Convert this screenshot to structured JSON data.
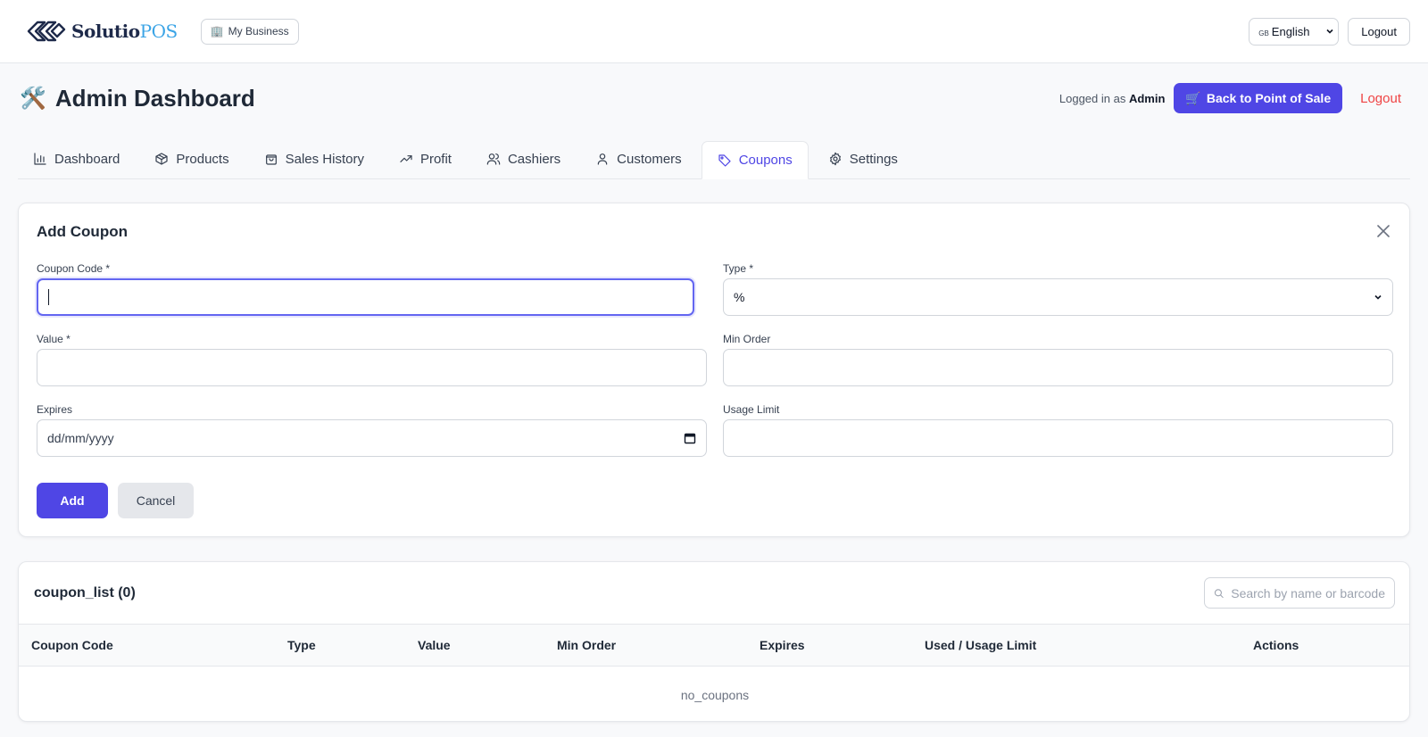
{
  "topbar": {
    "logo_text": "Solutio",
    "logo_text_accent": "POS",
    "business_label": "My Business",
    "language": "English",
    "language_flag": "GB",
    "logout_label": "Logout"
  },
  "header": {
    "title": "Admin Dashboard",
    "logged_in_prefix": "Logged in as",
    "logged_in_user": "Admin",
    "back_to_pos_label": "Back to Point of Sale",
    "logout_label": "Logout"
  },
  "tabs": [
    {
      "label": "Dashboard",
      "icon": "bar-chart-icon"
    },
    {
      "label": "Products",
      "icon": "box-icon"
    },
    {
      "label": "Sales History",
      "icon": "shopping-bag-icon"
    },
    {
      "label": "Profit",
      "icon": "trending-up-icon"
    },
    {
      "label": "Cashiers",
      "icon": "users-icon"
    },
    {
      "label": "Customers",
      "icon": "user-icon"
    },
    {
      "label": "Coupons",
      "icon": "tag-icon",
      "active": true
    },
    {
      "label": "Settings",
      "icon": "gear-icon"
    }
  ],
  "form": {
    "title": "Add Coupon",
    "coupon_code_label": "Coupon Code *",
    "coupon_code_value": "",
    "type_label": "Type *",
    "type_value": "%",
    "value_label": "Value *",
    "value_value": "",
    "min_order_label": "Min Order",
    "min_order_value": "",
    "expires_label": "Expires",
    "expires_placeholder": "dd/mm/yyyy",
    "usage_limit_label": "Usage Limit",
    "usage_limit_value": "",
    "add_label": "Add",
    "cancel_label": "Cancel"
  },
  "list": {
    "title": "coupon_list (0)",
    "search_placeholder": "Search by name or barcode",
    "columns": [
      "Coupon Code",
      "Type",
      "Value",
      "Min Order",
      "Expires",
      "Used / Usage Limit",
      "Actions"
    ],
    "empty_text": "no_coupons"
  },
  "colors": {
    "primary": "#4f46e5",
    "danger": "#ef4444",
    "logo_accent": "#3ba4e6"
  }
}
